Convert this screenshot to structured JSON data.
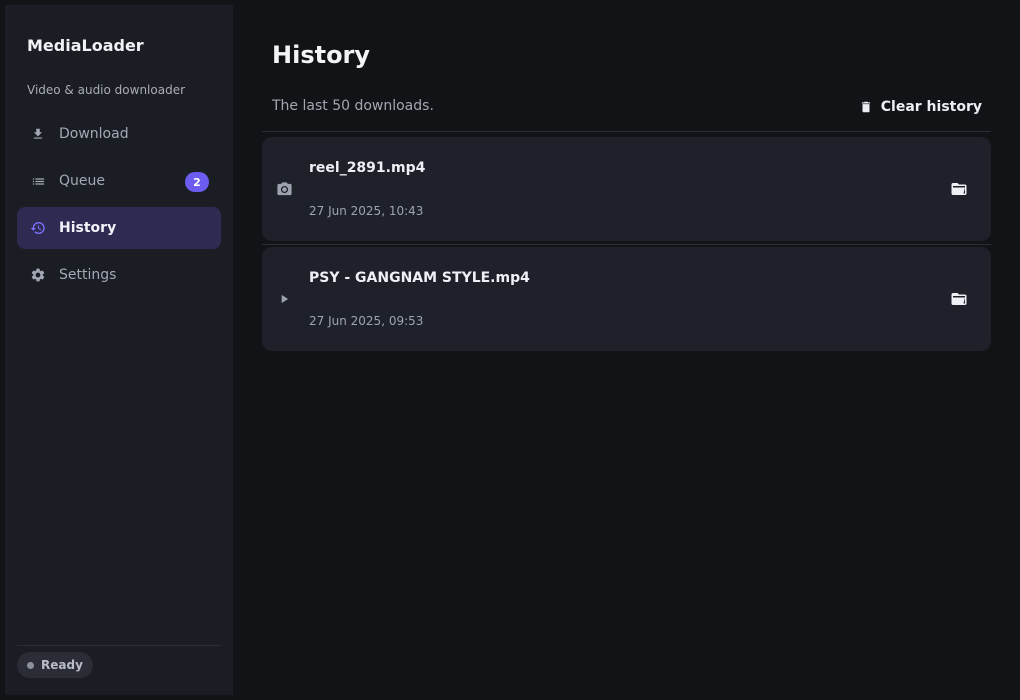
{
  "sidebar": {
    "brand": "MediaLoader",
    "tagline": "Video & audio downloader",
    "items": [
      {
        "label": "Download",
        "icon": "download-icon"
      },
      {
        "label": "Queue",
        "icon": "list-icon",
        "badge": "2"
      },
      {
        "label": "History",
        "icon": "history-icon",
        "active": true
      },
      {
        "label": "Settings",
        "icon": "gear-icon"
      }
    ],
    "status": "Ready"
  },
  "main": {
    "title": "History",
    "subtitle": "The last 50 downloads.",
    "clear_label": "Clear history",
    "entries": [
      {
        "filename": "reel_2891.mp4",
        "date": "27 Jun 2025, 10:43",
        "type_icon": "camera-icon"
      },
      {
        "filename": "PSY - GANGNAM STYLE.mp4",
        "date": "27 Jun 2025, 09:53",
        "type_icon": "play-icon"
      }
    ]
  },
  "colors": {
    "accent": "#6c5cf0",
    "active_nav_bg": "#2e2a52",
    "background": "#121317",
    "sidebar_bg": "#1b1d24",
    "card_bg": "#1e2129"
  }
}
